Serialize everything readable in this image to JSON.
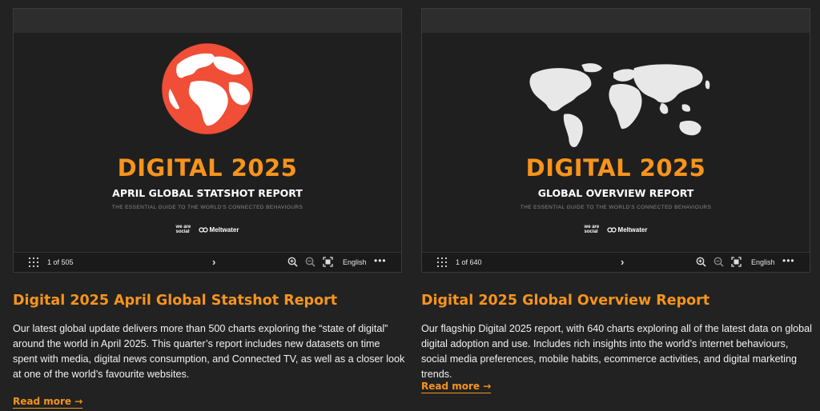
{
  "cards": [
    {
      "slide": {
        "title": "DIGITAL 2025",
        "subtitle": "APRIL GLOBAL STATSHOT REPORT",
        "tagline": "THE ESSENTIAL GUIDE TO THE WORLD'S CONNECTED BEHAVIOURS",
        "logo_we_are_social": "we are social",
        "logo_meltwater": "Meltwater",
        "art": "globe-icon",
        "art_color": "#f04e36"
      },
      "toolbar": {
        "page_indicator": "1 of 505",
        "next": "›",
        "language": "English",
        "more": "•••"
      },
      "title": "Digital 2025 April Global Statshot Report",
      "description": "Our latest global update delivers more than 500 charts exploring the “state of digital” around the world in April 2025. This quarter’s report includes new datasets on time spent with media, digital news consumption, and Connected TV, as well as a closer look at one of the world’s favourite websites.",
      "read_more": "Read more →"
    },
    {
      "slide": {
        "title": "DIGITAL 2025",
        "subtitle": "GLOBAL OVERVIEW REPORT",
        "tagline": "THE ESSENTIAL GUIDE TO THE WORLD'S CONNECTED BEHAVIOURS",
        "logo_we_are_social": "we are social",
        "logo_meltwater": "Meltwater",
        "art": "world-map-icon",
        "art_color": "#e8e8e8"
      },
      "toolbar": {
        "page_indicator": "1 of 640",
        "next": "›",
        "language": "English",
        "more": "•••"
      },
      "title": "Digital 2025 Global Overview Report",
      "description": "Our flagship Digital 2025 report, with 640 charts exploring all of the latest data on global digital adoption and use. Includes rich insights into the world’s internet behaviours, social media preferences, mobile habits, ecommerce activities, and digital marketing trends.",
      "read_more": "Read more →"
    }
  ],
  "colors": {
    "accent": "#f7941d",
    "background": "#222222"
  }
}
